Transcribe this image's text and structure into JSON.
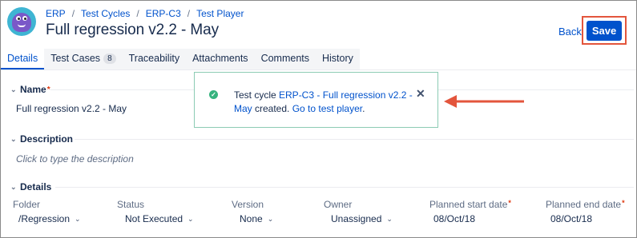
{
  "breadcrumb": [
    "ERP",
    "Test Cycles",
    "ERP-C3",
    "Test Player"
  ],
  "page_title": "Full regression v2.2 - May",
  "header": {
    "back_label": "Back",
    "save_label": "Save"
  },
  "tabs": [
    {
      "label": "Details",
      "active": true
    },
    {
      "label": "Test Cases",
      "count": "8"
    },
    {
      "label": "Traceability"
    },
    {
      "label": "Attachments"
    },
    {
      "label": "Comments"
    },
    {
      "label": "History"
    }
  ],
  "name_section": {
    "label": "Name",
    "value": "Full regression v2.2 - May"
  },
  "description_section": {
    "label": "Description",
    "placeholder": "Click to type the description"
  },
  "details_section": {
    "label": "Details",
    "fields": [
      {
        "label": "Folder",
        "value": "/Regression",
        "required": false
      },
      {
        "label": "Status",
        "value": "Not Executed",
        "required": false
      },
      {
        "label": "Version",
        "value": "None",
        "required": false
      },
      {
        "label": "Owner",
        "value": "Unassigned",
        "required": false
      },
      {
        "label": "Planned start date",
        "value": "08/Oct/18",
        "required": true
      },
      {
        "label": "Planned end date",
        "value": "08/Oct/18",
        "required": true
      }
    ]
  },
  "toast": {
    "prefix": "Test cycle ",
    "cycle_link": "ERP-C3 - Full regression v2.2 - May",
    "middle": " created. ",
    "action_link": "Go to test player",
    "suffix": "."
  },
  "required_mark": "*",
  "colors": {
    "accent": "#0052cc",
    "highlight": "#e3553c",
    "success": "#36b37e"
  },
  "icons": [
    "app-avatar-icon",
    "check-circle-icon",
    "close-icon",
    "chevron-down-icon",
    "red-arrow-annotation"
  ]
}
